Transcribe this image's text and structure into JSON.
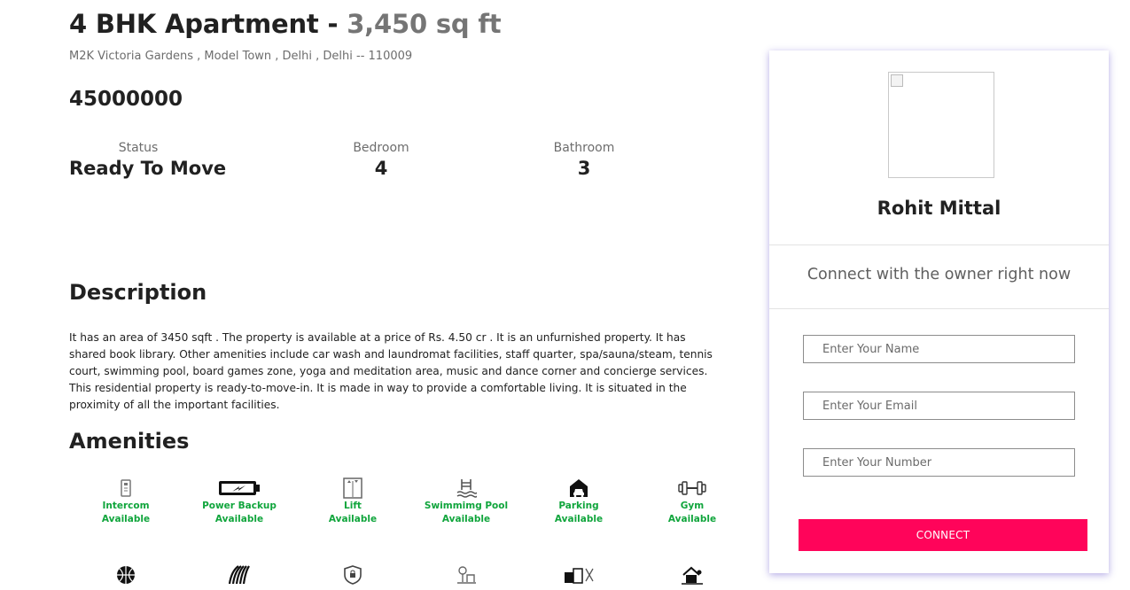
{
  "listing": {
    "title": "4 BHK Apartment - ",
    "area": "3,450 sq ft",
    "address": "M2K Victoria Gardens , Model Town , Delhi , Delhi -- 110009",
    "price": "45000000"
  },
  "stats": {
    "status_label": "Status",
    "status_value": "Ready To Move",
    "bedroom_label": "Bedroom",
    "bedroom_value": "4",
    "bathroom_label": "Bathroom",
    "bathroom_value": "3"
  },
  "description": {
    "heading": "Description",
    "text": "It has an area of 3450 sqft . The property is available at a price of Rs. 4.50 cr . It is an unfurnished property. It has shared book library. Other amenities include car wash and laundromat facilities, staff quarter, spa/sauna/steam, tennis court, swimming pool, board games zone, yoga and meditation area, music and dance corner and concierge services. This residential property is ready-to-move-in. It is made in way to provide a comfortable living. It is situated in the proximity of all the important facilities."
  },
  "amenities": {
    "heading": "Amenities",
    "status_color": "#10a53c",
    "items": [
      {
        "name": "Intercom",
        "status": "Available",
        "icon": "intercom-icon"
      },
      {
        "name": "Power Backup",
        "status": "Available",
        "icon": "battery-icon"
      },
      {
        "name": "Lift",
        "status": "Available",
        "icon": "lift-icon"
      },
      {
        "name": "Swimmimg Pool",
        "status": "Available",
        "icon": "pool-icon"
      },
      {
        "name": "Parking",
        "status": "Available",
        "icon": "car-icon"
      },
      {
        "name": "Gym",
        "status": "Available",
        "icon": "dumbbell-icon"
      }
    ],
    "second_row_icons": [
      "basketball-icon",
      "track-icon",
      "security-shield-icon",
      "garden-icon",
      "clubhouse-icon",
      "house-icon"
    ]
  },
  "contact": {
    "owner_name": "Rohit Mittal",
    "prompt": "Connect with the owner right now",
    "name_placeholder": "Enter Your Name",
    "email_placeholder": "Enter Your Email",
    "number_placeholder": "Enter Your Number",
    "button_label": "CONNECT",
    "button_color": "#ff045a"
  }
}
